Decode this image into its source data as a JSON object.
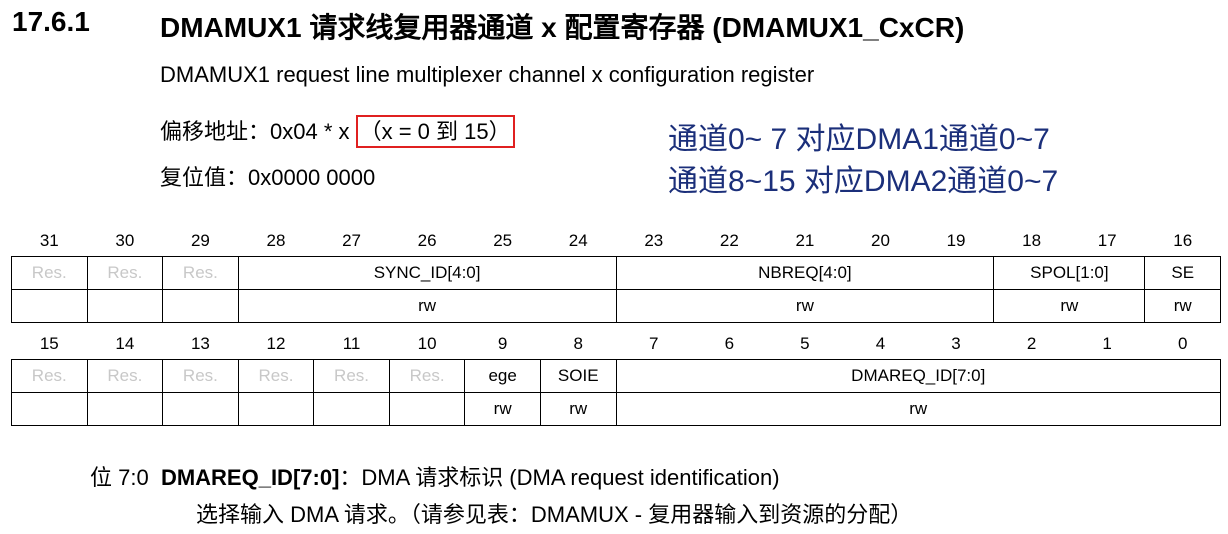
{
  "section": {
    "number": "17.6.1",
    "title": "DMAMUX1 请求线复用器通道 x 配置寄存器 (DMAMUX1_CxCR)",
    "subtitle": "DMAMUX1 request line multiplexer channel x configuration register"
  },
  "offset": {
    "prefix": "偏移地址：0x04 * x ",
    "boxed": "（x = 0 到 15）"
  },
  "reset": "复位值：0x0000 0000",
  "annotation": {
    "line1": "通道0~ 7   对应DMA1通道0~7",
    "line2": "通道8~15  对应DMA2通道0~7"
  },
  "register_high": {
    "bit_numbers": [
      "31",
      "30",
      "29",
      "28",
      "27",
      "26",
      "25",
      "24",
      "23",
      "22",
      "21",
      "20",
      "19",
      "18",
      "17",
      "16"
    ],
    "fields": [
      {
        "name": "Res.",
        "access": ""
      },
      {
        "name": "Res.",
        "access": ""
      },
      {
        "name": "Res.",
        "access": ""
      },
      {
        "name": "SYNC_ID[4:0]",
        "access": "rw"
      },
      {
        "name": "NBREQ[4:0]",
        "access": "rw"
      },
      {
        "name": "SPOL[1:0]",
        "access": "rw"
      },
      {
        "name": "SE",
        "access": "rw"
      }
    ]
  },
  "register_low": {
    "bit_numbers": [
      "15",
      "14",
      "13",
      "12",
      "11",
      "10",
      "9",
      "8",
      "7",
      "6",
      "5",
      "4",
      "3",
      "2",
      "1",
      "0"
    ],
    "fields": [
      {
        "name": "Res.",
        "access": ""
      },
      {
        "name": "Res.",
        "access": ""
      },
      {
        "name": "Res.",
        "access": ""
      },
      {
        "name": "Res.",
        "access": ""
      },
      {
        "name": "Res.",
        "access": ""
      },
      {
        "name": "Res.",
        "access": ""
      },
      {
        "name": "ege",
        "access": "rw"
      },
      {
        "name": "SOIE",
        "access": "rw"
      },
      {
        "name": "DMAREQ_ID[7:0]",
        "access": "rw"
      }
    ]
  },
  "description": {
    "bits": "位 7:0",
    "field": "DMAREQ_ID[7:0]",
    "text": "：DMA 请求标识 (DMA request identification)",
    "detail": "选择输入 DMA 请求。（请参见表：DMAMUX - 复用器输入到资源的分配）"
  },
  "colors": {
    "annotation_text": "#1b2f7a",
    "highlight_box": "#e02020",
    "reserved_text": "#c8c8c8"
  }
}
